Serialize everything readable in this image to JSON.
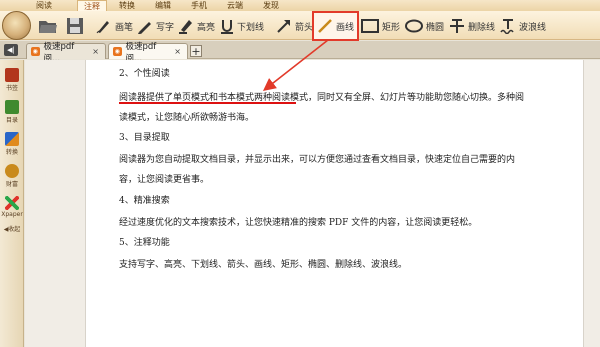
{
  "menu": {
    "tabs": [
      "阅读",
      "注释",
      "转换",
      "编辑",
      "手机",
      "云端",
      "发现"
    ],
    "active_index": 1
  },
  "toolbar": {
    "buttons": [
      {
        "label": "",
        "icon": "folder-open-icon"
      },
      {
        "label": "",
        "icon": "save-icon"
      },
      {
        "label": "画笔",
        "icon": "brush-icon"
      },
      {
        "label": "写字",
        "icon": "pencil-icon"
      },
      {
        "label": "高亮",
        "icon": "highlighter-icon"
      },
      {
        "label": "下划线",
        "icon": "underline-icon"
      },
      {
        "label": "箭头",
        "icon": "arrow-icon"
      },
      {
        "label": "画线",
        "icon": "line-icon",
        "active": true
      },
      {
        "label": "矩形",
        "icon": "rectangle-icon"
      },
      {
        "label": "椭圆",
        "icon": "ellipse-icon"
      },
      {
        "label": "删除线",
        "icon": "strikethrough-icon"
      },
      {
        "label": "波浪线",
        "icon": "wavy-line-icon"
      }
    ]
  },
  "tabs": {
    "toggle_label": "◀|",
    "documents": [
      {
        "label": "极速pdf阅...",
        "close": "×",
        "active": false
      },
      {
        "label": "极速pdf阅...",
        "close": "×",
        "active": true
      }
    ],
    "add_label": "+"
  },
  "sidebar": {
    "items": [
      {
        "label": "书签",
        "icon": "bookmark-icon"
      },
      {
        "label": "目录",
        "icon": "contents-icon"
      },
      {
        "label": "转换",
        "icon": "convert-icon"
      },
      {
        "label": "财富",
        "icon": "wealth-icon"
      },
      {
        "label": "Xpaper",
        "icon": "xpaper-icon"
      },
      {
        "label": "◀收起",
        "icon": "collapse-icon"
      }
    ]
  },
  "document": {
    "lines": [
      "2、个性阅读",
      "阅读器提供了单页模式和书本模式两种阅读模式，同时又有全屏、幻灯片等功能助您随心切换。多种阅",
      "读模式，让您随心所欲畅游书海。",
      "3、目录提取",
      "阅读器为您自动提取文档目录，并显示出来，可以方便您通过查看文档目录，快速定位自己需要的内",
      "容，让您阅读更省事。",
      "4、精准搜索",
      "经过速度优化的文本搜索技术，让您快速精准的搜索 PDF 文件的内容，让您阅读更轻松。",
      "5、注释功能",
      "支持写字、高亮、下划线、箭头、画线、矩形、椭圆、删除线、波浪线。"
    ]
  },
  "colors": {
    "accent_red": "#e23a2a",
    "toolbar_bg": "#f1ddb6",
    "page_bg": "#ffffff"
  }
}
